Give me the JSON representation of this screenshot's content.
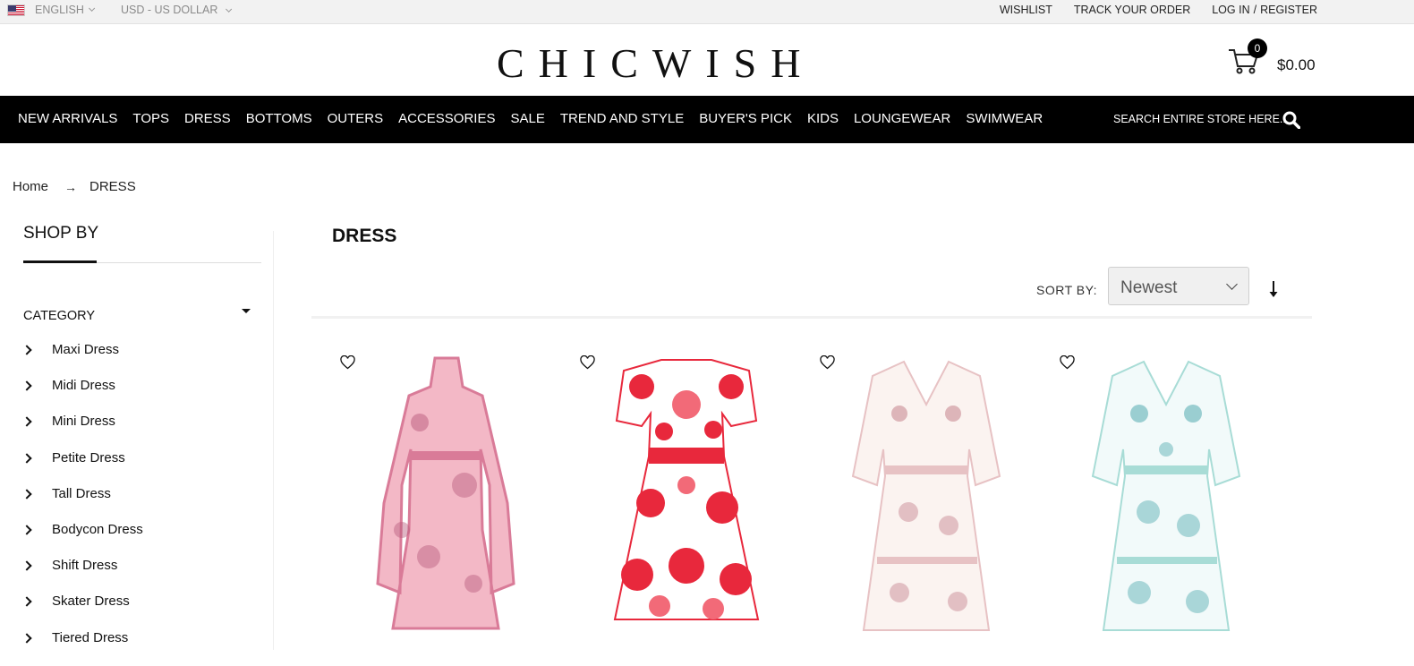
{
  "topbar": {
    "language": "ENGLISH",
    "currency": "USD - US DOLLAR",
    "links": {
      "wishlist": "WISHLIST",
      "track": "TRACK YOUR ORDER",
      "login": "LOG IN",
      "separator": "/",
      "register": "REGISTER"
    }
  },
  "header": {
    "logo": "CHICWISH",
    "cart_count": "0",
    "cart_total": "$0.00"
  },
  "nav": {
    "items": [
      "NEW ARRIVALS",
      "TOPS",
      "DRESS",
      "BOTTOMS",
      "OUTERS",
      "ACCESSORIES",
      "SALE",
      "TREND AND STYLE",
      "BUYER'S PICK",
      "KIDS",
      "LOUNGEWEAR",
      "SWIMWEAR"
    ],
    "search_placeholder": "SEARCH ENTIRE STORE HERE..."
  },
  "breadcrumb": {
    "home": "Home",
    "arrow": "→",
    "current": "DRESS"
  },
  "sidebar": {
    "title": "SHOP BY",
    "category_title": "CATEGORY",
    "categories": [
      "Maxi Dress",
      "Midi Dress",
      "Mini Dress",
      "Petite Dress",
      "Tall Dress",
      "Bodycon Dress",
      "Shift Dress",
      "Skater Dress",
      "Tiered Dress"
    ]
  },
  "main": {
    "title": "DRESS",
    "sort_label": "SORT BY:",
    "sort_value": "Newest"
  },
  "products": [
    {
      "name": "pink-ruffle-dress",
      "colors": {
        "base": "#f3b8c6",
        "accent": "#d97b98",
        "print": "#b95a7c"
      }
    },
    {
      "name": "red-rose-dress",
      "colors": {
        "base": "#ffffff",
        "accent": "#e8283c",
        "print": "#f26a78"
      }
    },
    {
      "name": "blush-floral-dress",
      "colors": {
        "base": "#fbf3f0",
        "accent": "#e7c2c4",
        "print": "#c98c95"
      }
    },
    {
      "name": "blue-floral-dress",
      "colors": {
        "base": "#f2fafa",
        "accent": "#a8dcd6",
        "print": "#5fb1b5"
      }
    }
  ],
  "icons": [
    "flag-us-icon",
    "cart-icon",
    "search-icon",
    "sort-direction-icon",
    "heart-icon",
    "chevron-right-icon",
    "caret-down-icon"
  ]
}
